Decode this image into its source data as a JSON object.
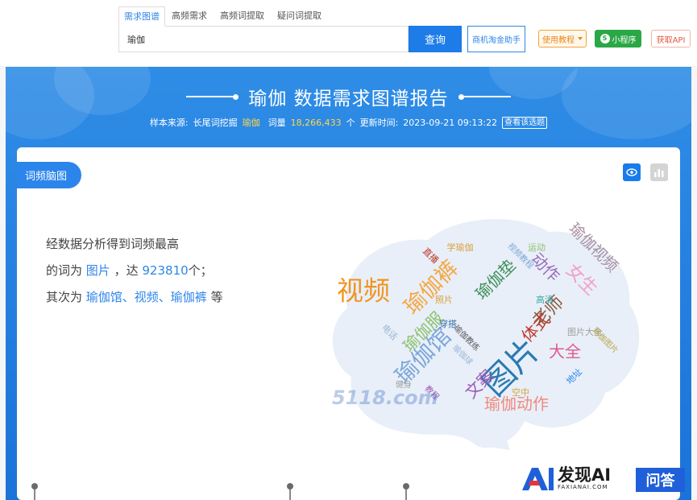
{
  "search": {
    "tabs": [
      "需求图谱",
      "高频需求",
      "高频词提取",
      "疑问词提取"
    ],
    "active_tab": 0,
    "query": "瑜伽",
    "search_button": "查询",
    "helper_button": "商机淘金助手",
    "tutorial_button": "使用教程",
    "miniprogram_button": "小程序",
    "api_button": "获取API"
  },
  "report": {
    "title": "瑜伽 数据需求图谱报告",
    "meta": {
      "source_label": "样本来源:",
      "source_value": "长尾词挖掘",
      "keyword": "瑜伽",
      "count_label": "词量",
      "count_value": "18,266,433",
      "count_unit": "个",
      "updated_label": "更新时间:",
      "updated_value": "2023-09-21 09:13:22",
      "view_button": "查看该选题"
    }
  },
  "card": {
    "label": "词频脑图",
    "summary": {
      "line1": "经数据分析得到词频最高",
      "line2_prefix": "的词为",
      "top_word": "图片",
      "line2_mid": "，达",
      "top_count": "923810",
      "line2_suffix": "个；",
      "line3_prefix": "其次为",
      "others": "瑜伽馆、视频、瑜伽裤",
      "line3_suffix": "等"
    }
  },
  "word_cloud": [
    {
      "text": "图片",
      "color": "#2a7ab0",
      "size": 40,
      "rotate": -45
    },
    {
      "text": "瑜伽馆",
      "color": "#7da7d9",
      "size": 28,
      "rotate": -45
    },
    {
      "text": "视频",
      "color": "#f0951f",
      "size": 33,
      "rotate": 0
    },
    {
      "text": "瑜伽裤",
      "color": "#f5a742",
      "size": 27,
      "rotate": -45
    },
    {
      "text": "瑜伽垫",
      "color": "#3e8e57",
      "size": 20,
      "rotate": -45
    },
    {
      "text": "瑜伽服",
      "color": "#8cc26c",
      "size": 20,
      "rotate": -45
    },
    {
      "text": "文案",
      "color": "#9b59b6",
      "size": 20,
      "rotate": -45
    },
    {
      "text": "瑜伽动作",
      "color": "#f08a7e",
      "size": 20,
      "rotate": 0
    },
    {
      "text": "大全",
      "color": "#e05a8a",
      "size": 20,
      "rotate": 0
    },
    {
      "text": "老师",
      "color": "#8b5a3c",
      "size": 22,
      "rotate": -45
    },
    {
      "text": "体式",
      "color": "#c0392b",
      "size": 20,
      "rotate": -45
    },
    {
      "text": "女生",
      "color": "#f2a0c8",
      "size": 22,
      "rotate": 45
    },
    {
      "text": "动作",
      "color": "#9b6bb8",
      "size": 20,
      "rotate": 45
    },
    {
      "text": "瑜伽视频",
      "color": "#a88fa0",
      "size": 19,
      "rotate": 45
    },
    {
      "text": "照片",
      "color": "#d9a23a",
      "size": 11,
      "rotate": 0
    },
    {
      "text": "穿搭",
      "color": "#3e6fa3",
      "size": 11,
      "rotate": 0
    },
    {
      "text": "高清",
      "color": "#3fa7a7",
      "size": 11,
      "rotate": 0
    },
    {
      "text": "电话",
      "color": "#9ab7d6",
      "size": 11,
      "rotate": 45
    },
    {
      "text": "学瑜伽",
      "color": "#d9a23a",
      "size": 11,
      "rotate": 0
    },
    {
      "text": "直播",
      "color": "#c0392b",
      "size": 11,
      "rotate": 45
    },
    {
      "text": "运动",
      "color": "#8cc26c",
      "size": 11,
      "rotate": 0
    },
    {
      "text": "视频教程",
      "color": "#7da7d9",
      "size": 10,
      "rotate": 45
    },
    {
      "text": "瑜伽教练",
      "color": "#5a5a5a",
      "size": 10,
      "rotate": 45
    },
    {
      "text": "瑜伽球",
      "color": "#9ab7d6",
      "size": 10,
      "rotate": 45
    },
    {
      "text": "图片大全",
      "color": "#a0a0a0",
      "size": 11,
      "rotate": 0
    },
    {
      "text": "瑜伽图片",
      "color": "#b8a84a",
      "size": 10,
      "rotate": 45
    },
    {
      "text": "地址",
      "color": "#2e86e8",
      "size": 11,
      "rotate": -45
    },
    {
      "text": "空中",
      "color": "#d9a23a",
      "size": 11,
      "rotate": 0
    },
    {
      "text": "健身",
      "color": "#a0a0a0",
      "size": 10,
      "rotate": 0
    },
    {
      "text": "教程",
      "color": "#9b59b6",
      "size": 10,
      "rotate": 45
    }
  ],
  "watermark": {
    "site": "5118.com",
    "brand_name": "发现AI",
    "brand_sub": "FAXIANAI.COM",
    "qa": "问答"
  },
  "colors": {
    "accent": "#1d7ce8",
    "banner_top": "#2f8de6",
    "banner_bottom": "#1a73d9",
    "highlight": "#ffd74a"
  }
}
